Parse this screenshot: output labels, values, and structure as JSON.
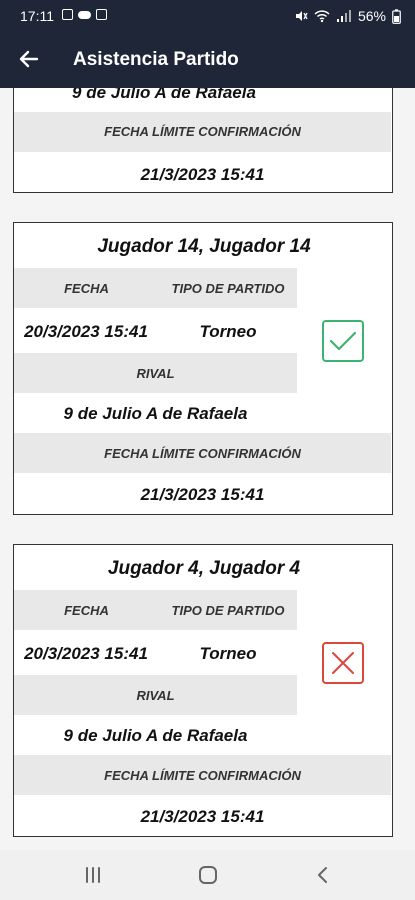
{
  "status_bar": {
    "time": "17:11",
    "battery": "56%"
  },
  "app_bar": {
    "title": "Asistencia Partido"
  },
  "labels": {
    "fecha": "FECHA",
    "tipo": "TIPO DE PARTIDO",
    "rival": "RIVAL",
    "limite": "FECHA LÍMITE CONFIRMACIÓN"
  },
  "cards": [
    {
      "rival": "9 de Julio A de Rafaela",
      "limite": "21/3/2023  15:41"
    },
    {
      "jugador": "Jugador 14, Jugador 14",
      "fecha": "20/3/2023  15:41",
      "tipo": "Torneo",
      "rival": "9 de Julio A de Rafaela",
      "limite": "21/3/2023  15:41",
      "status": "confirmed"
    },
    {
      "jugador": "Jugador 4, Jugador 4",
      "fecha": "20/3/2023  15:41",
      "tipo": "Torneo",
      "rival": "9 de Julio A de Rafaela",
      "limite": "21/3/2023  15:41",
      "status": "declined"
    }
  ],
  "colors": {
    "header_bg": "#1e2637",
    "confirmed": "#3cb371",
    "declined": "#d9483b",
    "band": "#e8e8e8"
  },
  "icons": {
    "back": "arrow-left-icon",
    "confirmed": "check-icon",
    "declined": "x-icon"
  }
}
